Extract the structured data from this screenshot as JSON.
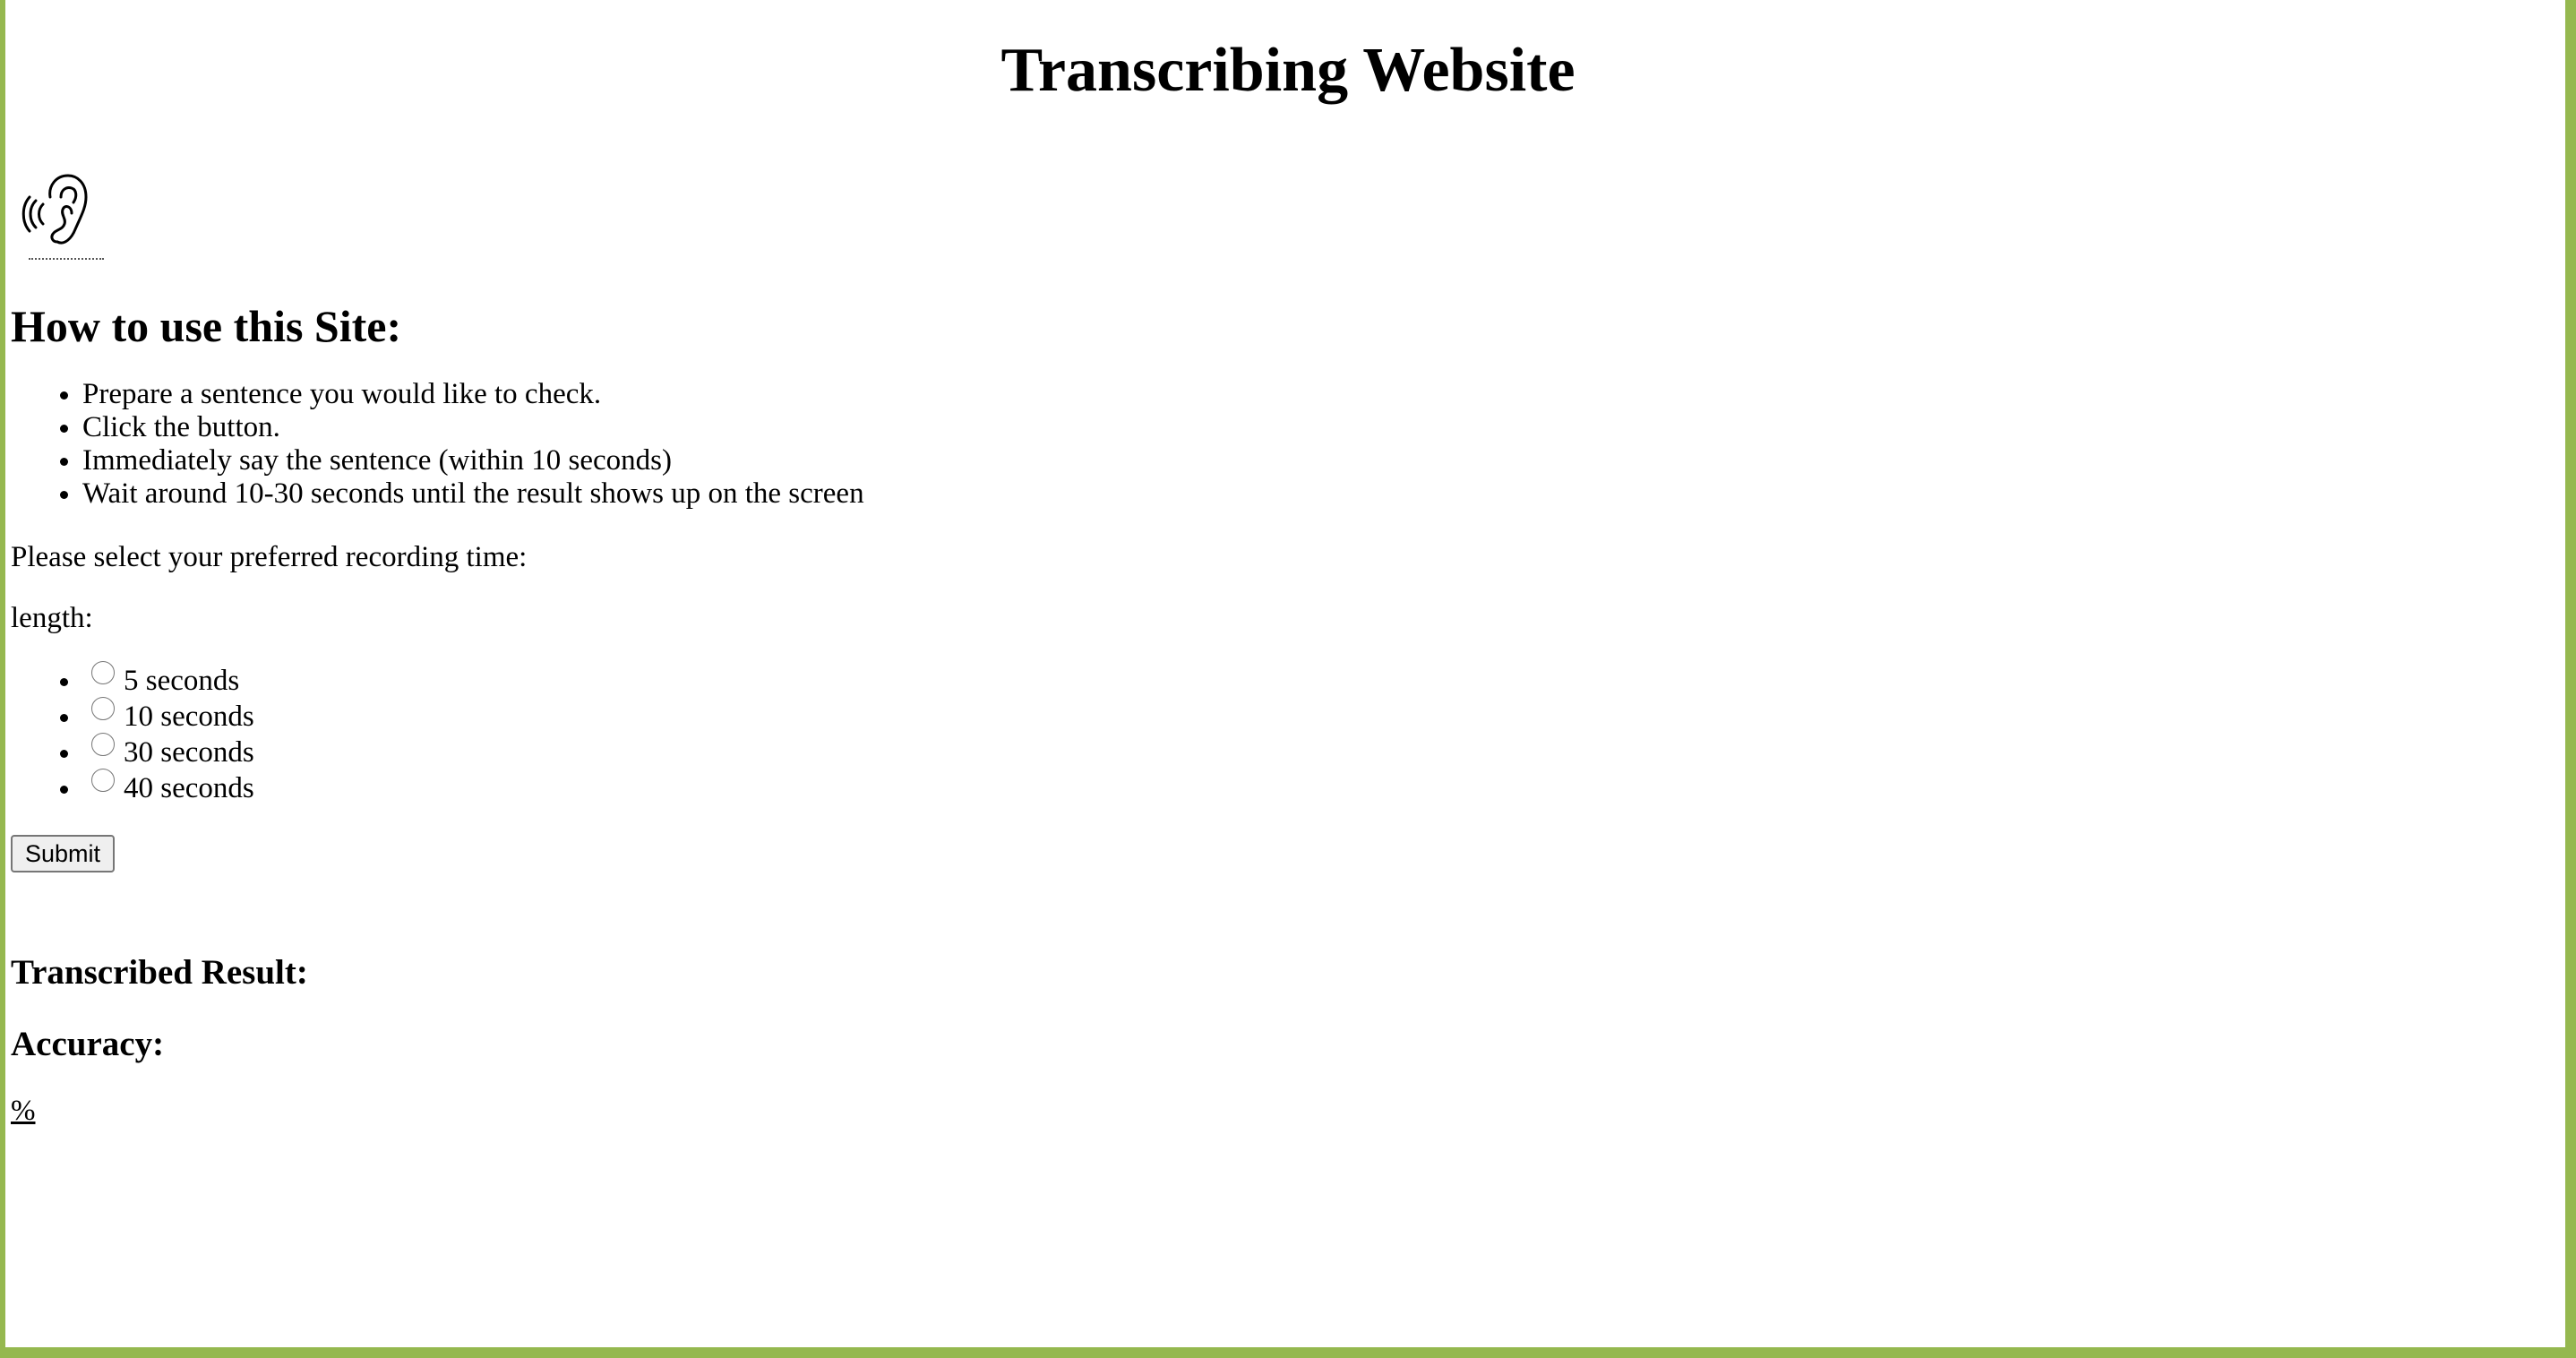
{
  "page": {
    "title": "Transcribing Website",
    "border_color": "#95b84f"
  },
  "logo": {
    "icon": "ear-sound-icon"
  },
  "instructions": {
    "heading": "How to use this Site:",
    "steps": [
      "Prepare a sentence you would like to check.",
      "Click the button.",
      "Immediately say the sentence (within 10 seconds)",
      "Wait around 10-30 seconds until the result shows up on the screen"
    ]
  },
  "recording": {
    "prompt": "Please select your preferred recording time:",
    "length_label": "length:",
    "options": [
      "5 seconds",
      "10 seconds",
      "30 seconds",
      "40 seconds"
    ],
    "submit_label": "Submit"
  },
  "result": {
    "transcribed_label": "Transcribed Result:",
    "accuracy_label": "Accuracy:",
    "accuracy_value": "%"
  }
}
